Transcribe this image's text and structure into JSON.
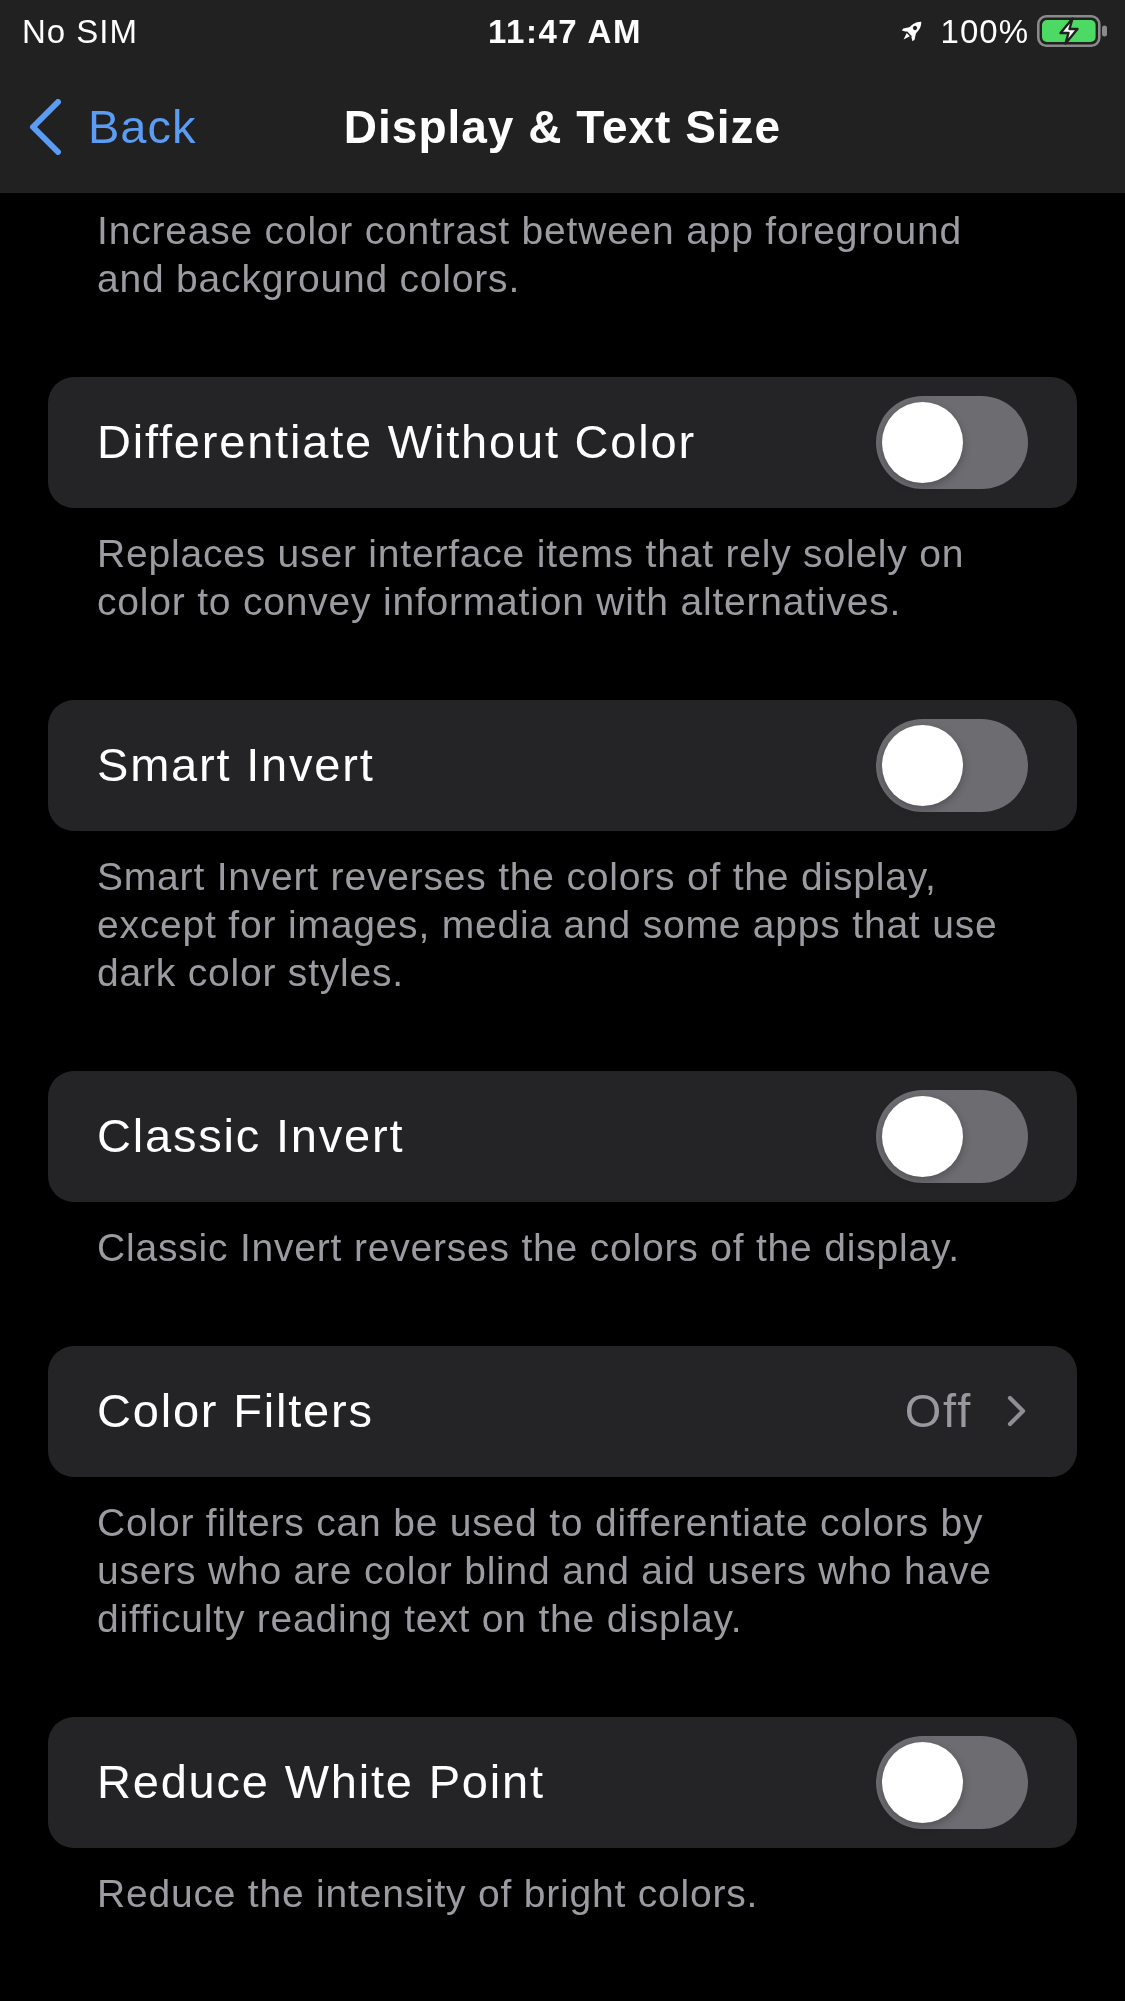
{
  "status_bar": {
    "carrier": "No SIM",
    "time": "11:47 AM",
    "battery": "100%",
    "charging": true
  },
  "nav_bar": {
    "back": "Back",
    "title": "Display & Text Size"
  },
  "intro_footer": "Increase color contrast between app foreground and background colors.",
  "rows": [
    {
      "kind": "toggle",
      "label": "Differentiate Without Color",
      "on": false,
      "footer": "Replaces user interface items that rely solely on color to convey information with alternatives."
    },
    {
      "kind": "toggle",
      "label": "Smart Invert",
      "on": false,
      "footer": "Smart Invert reverses the colors of the display, except for images, media and some apps that use dark color styles."
    },
    {
      "kind": "toggle",
      "label": "Classic Invert",
      "on": false,
      "footer": "Classic Invert reverses the colors of the display."
    },
    {
      "kind": "link",
      "label": "Color Filters",
      "value": "Off",
      "footer": "Color filters can be used to differentiate colors by users who are color blind and aid users who have difficulty reading text on the display."
    },
    {
      "kind": "toggle",
      "label": "Reduce White Point",
      "on": false,
      "footer": "Reduce the intensity of bright colors."
    }
  ]
}
